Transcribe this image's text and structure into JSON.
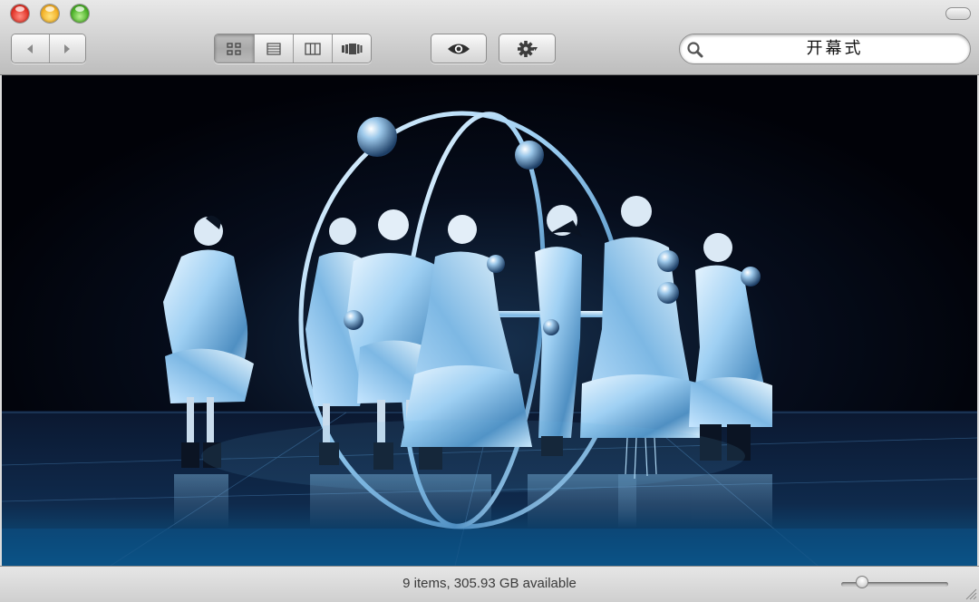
{
  "toolbar": {
    "nav": {
      "back": "back-arrow",
      "forward": "forward-arrow"
    },
    "views": [
      {
        "name": "icon-view",
        "active": true
      },
      {
        "name": "list-view",
        "active": false
      },
      {
        "name": "column-view",
        "active": false
      },
      {
        "name": "cover-flow-view",
        "active": false
      }
    ],
    "quick_look_icon": "eye-icon",
    "action_icon": "gear-icon",
    "search": {
      "value": "开幕式",
      "icon": "magnifier-icon"
    }
  },
  "content": {
    "description_icon": "photo",
    "accent_color": "#7fc6ff"
  },
  "statusbar": {
    "text": "9 items, 305.93 GB available",
    "zoom_level": 0.15
  },
  "colors": {
    "close": "#e3382c",
    "minimize": "#f4b32a",
    "zoom": "#4fb32c"
  }
}
